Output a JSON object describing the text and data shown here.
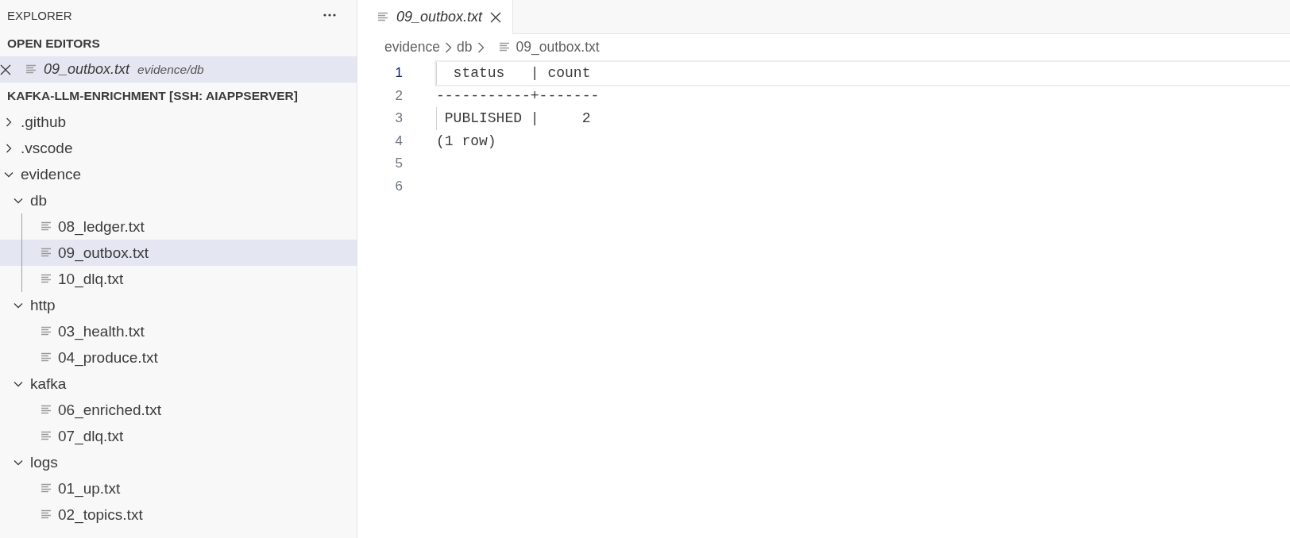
{
  "sidebar": {
    "title": "EXPLORER",
    "open_editors": {
      "title": "OPEN EDITORS",
      "items": [
        {
          "name": "09_outbox.txt",
          "path": "evidence/db",
          "selected": true
        }
      ]
    },
    "project": {
      "title": "KAFKA-LLM-ENRICHMENT [SSH: AIAPPSERVER]",
      "tree": [
        {
          "kind": "folder",
          "name": ".github",
          "expanded": false
        },
        {
          "kind": "folder",
          "name": ".vscode",
          "expanded": false
        },
        {
          "kind": "folder",
          "name": "evidence",
          "expanded": true,
          "children": [
            {
              "kind": "folder",
              "name": "db",
              "expanded": true,
              "children": [
                {
                  "kind": "file",
                  "name": "08_ledger.txt",
                  "selected": false
                },
                {
                  "kind": "file",
                  "name": "09_outbox.txt",
                  "selected": true
                },
                {
                  "kind": "file",
                  "name": "10_dlq.txt",
                  "selected": false
                }
              ]
            },
            {
              "kind": "folder",
              "name": "http",
              "expanded": true,
              "children": [
                {
                  "kind": "file",
                  "name": "03_health.txt",
                  "selected": false
                },
                {
                  "kind": "file",
                  "name": "04_produce.txt",
                  "selected": false
                }
              ]
            },
            {
              "kind": "folder",
              "name": "kafka",
              "expanded": true,
              "children": [
                {
                  "kind": "file",
                  "name": "06_enriched.txt",
                  "selected": false
                },
                {
                  "kind": "file",
                  "name": "07_dlq.txt",
                  "selected": false
                }
              ]
            },
            {
              "kind": "folder",
              "name": "logs",
              "expanded": true,
              "children": [
                {
                  "kind": "file",
                  "name": "01_up.txt",
                  "selected": false
                },
                {
                  "kind": "file",
                  "name": "02_topics.txt",
                  "selected": false
                }
              ]
            }
          ]
        }
      ]
    }
  },
  "editor": {
    "tabs": [
      {
        "label": "09_outbox.txt",
        "selected": true
      }
    ],
    "breadcrumb": [
      "evidence",
      "db",
      "09_outbox.txt"
    ],
    "lines": [
      {
        "number": "1",
        "text": "  status   | count",
        "current": true
      },
      {
        "number": "2",
        "text": "-----------+-------",
        "current": false
      },
      {
        "number": "3",
        "text": " PUBLISHED |     2",
        "current": false
      },
      {
        "number": "4",
        "text": "(1 row)",
        "current": false
      },
      {
        "number": "5",
        "current": false
      },
      {
        "number": "6",
        "current": false
      }
    ]
  }
}
